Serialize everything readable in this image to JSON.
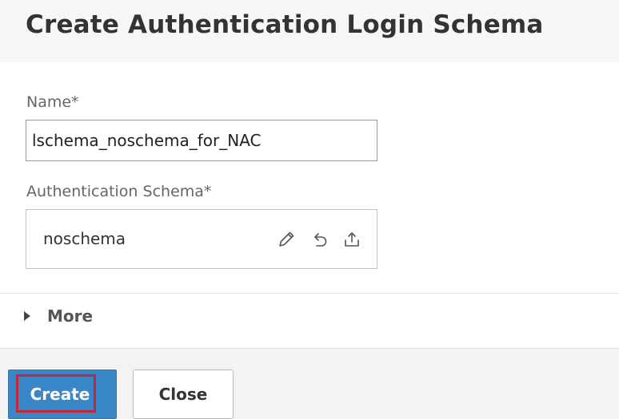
{
  "dialog": {
    "title": "Create Authentication Login Schema"
  },
  "form": {
    "name_label": "Name*",
    "name_value": "lschema_noschema_for_NAC",
    "schema_label": "Authentication Schema*",
    "schema_value": "noschema",
    "schema_icons": [
      "pencil-icon",
      "undo-icon",
      "upload-icon"
    ]
  },
  "more": {
    "label": "More",
    "icon": "caret-right-icon"
  },
  "footer": {
    "create_label": "Create",
    "close_label": "Close"
  },
  "colors": {
    "primary_button": "#3a87c8",
    "highlight_border": "#c5283a"
  }
}
